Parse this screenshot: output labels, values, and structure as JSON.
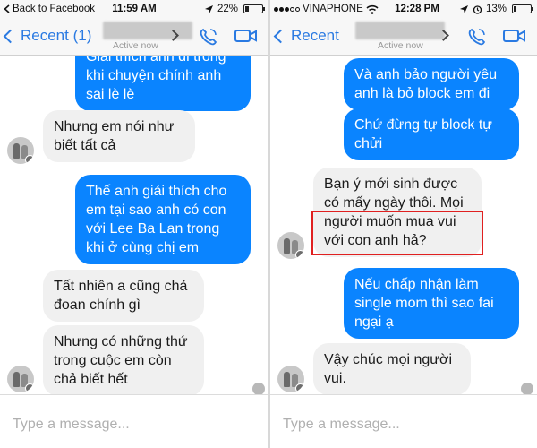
{
  "left": {
    "status": {
      "back_app": "Back to Facebook",
      "time": "11:59 AM",
      "battery_percent": "22%",
      "battery_level": 0.22
    },
    "nav": {
      "back_label": "Recent (1)",
      "subtitle": "Active now"
    },
    "messages": [
      {
        "dir": "out",
        "text": "Giải thích anh đi trong khi chuyện chính anh sai lè lè"
      },
      {
        "dir": "in",
        "text": "Nhưng em nói như biết tất cả"
      },
      {
        "dir": "out",
        "text": "Thế anh giải thích cho em tại sao anh có con với Lee Ba Lan trong khi ở cùng chị em"
      },
      {
        "dir": "in",
        "text": "Tất nhiên a cũng chả đoan chính gì"
      },
      {
        "dir": "in",
        "text": "Nhưng có những thứ trong cuộc em còn chả biết hết"
      }
    ],
    "composer_placeholder": "Type a message..."
  },
  "right": {
    "status": {
      "carrier": "VINAPHONE",
      "time": "12:28 PM",
      "battery_percent": "13%",
      "battery_level": 0.13
    },
    "nav": {
      "back_label": "Recent",
      "subtitle": "Active now"
    },
    "messages": [
      {
        "dir": "out",
        "text": "Và anh bảo người yêu anh là bỏ block em đi"
      },
      {
        "dir": "out",
        "text": "Chứ đừng tự block tự chửi"
      },
      {
        "dir": "in",
        "text": "Bạn ý mới sinh được có mấy ngày thôi. Mọi người muốn mua vui với con anh hả?"
      },
      {
        "dir": "out",
        "text": "Nếu chấp nhận làm single mom thì sao fai ngại ạ"
      },
      {
        "dir": "in",
        "text": "Vậy chúc mọi người vui."
      }
    ],
    "composer_placeholder": "Type a message..."
  },
  "colors": {
    "accent": "#2a7ae2",
    "outgoing_bubble": "#0a84ff",
    "incoming_bubble": "#f0f0f0",
    "highlight_box": "#e02020"
  },
  "icons": [
    "back-chevron-icon",
    "phone-icon",
    "video-camera-icon",
    "signal-dots-icon",
    "wifi-icon",
    "location-arrow-icon",
    "alarm-icon",
    "battery-icon"
  ]
}
